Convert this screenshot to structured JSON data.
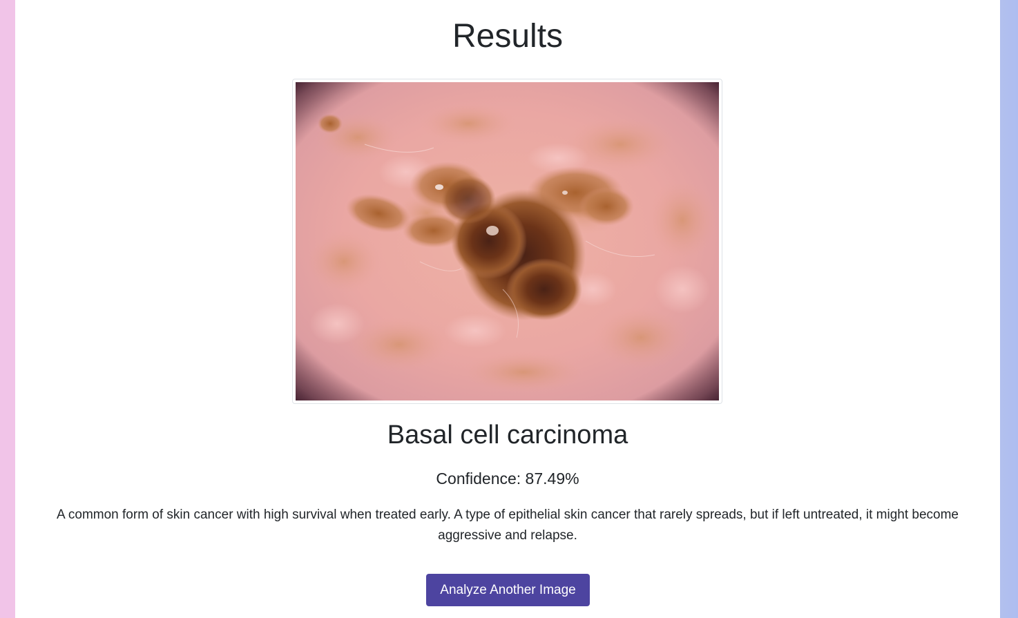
{
  "page": {
    "title": "Results"
  },
  "result": {
    "image_icon": "dermoscopy-lesion-image",
    "diagnosis": "Basal cell carcinoma",
    "confidence_label": "Confidence: 87.49%",
    "confidence_value": 87.49,
    "description": "A common form of skin cancer with high survival when treated early. A type of epithelial skin cancer that rarely spreads, but if left untreated, it might become aggressive and relapse."
  },
  "actions": {
    "analyze_another_label": "Analyze Another Image"
  },
  "colors": {
    "left_stripe": "#f1c4e8",
    "right_stripe": "#aebdf0",
    "button_bg": "#4d44a0",
    "button_text": "#ffffff",
    "text": "#212529"
  }
}
